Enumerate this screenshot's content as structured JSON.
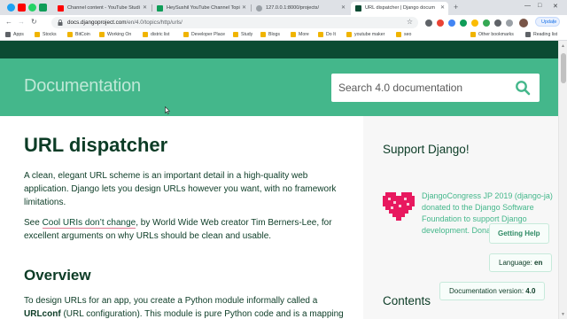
{
  "browser": {
    "tabs": [
      {
        "title": "Channel content - YouTube Studi",
        "favicon_color": "#ff0000"
      },
      {
        "title": "HeySushil YouTube Channel Topi",
        "favicon_color": "#0f9d58"
      },
      {
        "title": "127.0.0.1:8000/projects/",
        "favicon_color": "#9aa0a6"
      },
      {
        "title": "URL dispatcher | Django docum",
        "favicon_color": "#0c4b33"
      }
    ],
    "address": {
      "domain": "docs.djangoproject.com",
      "path": "/en/4.0/topics/http/urls/"
    },
    "update_label": "Update",
    "bookmarks": [
      {
        "label": "Apps",
        "icon": "apps-grid-icon"
      },
      {
        "label": "Stocks"
      },
      {
        "label": "BitCoin"
      },
      {
        "label": "Working On"
      },
      {
        "label": "distric list"
      },
      {
        "label": "Developer Place"
      },
      {
        "label": "Study"
      },
      {
        "label": "Blogs"
      },
      {
        "label": "More"
      },
      {
        "label": "Do It"
      },
      {
        "label": "youtube maker"
      },
      {
        "label": "seo"
      }
    ],
    "other_bookmarks": "Other bookmarks",
    "reading_list": "Reading list"
  },
  "django": {
    "hero_title": "Documentation",
    "search_placeholder": "Search 4.0 documentation",
    "page_title": "URL dispatcher",
    "intro": "A clean, elegant URL scheme is an important detail in a high-quality web application. Django lets you design URLs however you want, with no framework limitations.",
    "see_prefix": "See ",
    "see_link": "Cool URIs don’t change",
    "see_suffix": ", by World Wide Web creator Tim Berners-Lee, for excellent arguments on why URLs should be clean and usable.",
    "overview_heading": "Overview",
    "overview_text_1": "To design URLs for an app, you create a Python module informally called a",
    "overview_bold": "URLconf",
    "overview_text_2": " (URL configuration). This module is pure Python code and is a mapping",
    "sidebar": {
      "support_heading": "Support Django!",
      "donation_text": "DjangoCongress JP 2019 (django-ja) donated to the Django Software Foundation to support Django development. Donate today!",
      "contents_heading": "Contents"
    },
    "floating": {
      "help": "Getting Help",
      "language_label": "Language: ",
      "language_value": "en",
      "version_label": "Documentation version: ",
      "version_value": "4.0"
    },
    "colors": {
      "dark_green": "#0c4b33",
      "hero_green": "#44b78b",
      "text_green": "#0c3c26",
      "heart_pink": "#e8195f"
    }
  }
}
